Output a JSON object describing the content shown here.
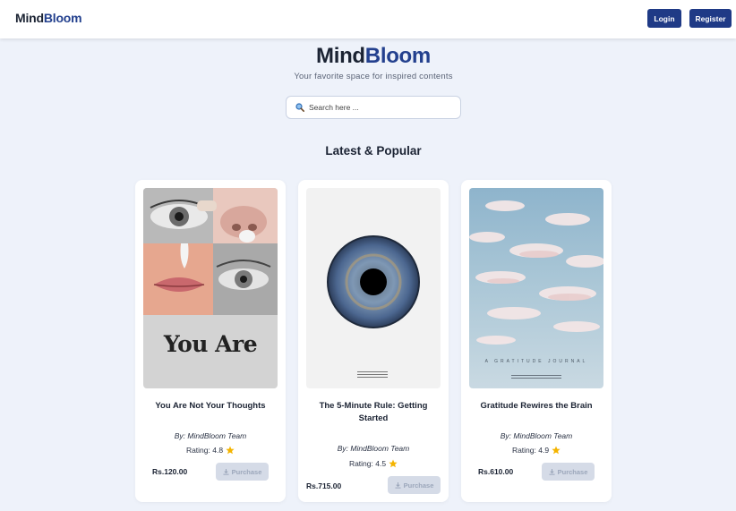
{
  "nav": {
    "logo_part1": "Mind",
    "logo_part2": "Bloom",
    "login_label": "Login",
    "register_label": "Register"
  },
  "hero": {
    "title_part1": "Mind",
    "title_part2": "Bloom",
    "subtitle": "Your favorite space for inspired contents"
  },
  "search": {
    "placeholder": "Search here ...",
    "icon": "search-icon"
  },
  "section": {
    "title": "Latest & Popular"
  },
  "cards": [
    {
      "title": "You Are Not Your Thoughts",
      "cover_text": "You Are",
      "byline": "By: MindBloom Team",
      "rating": "Rating: 4.8",
      "price": "Rs.120.00",
      "purchase_label": "Purchase"
    },
    {
      "title": "The 5-Minute Rule: Getting Started",
      "byline": "By: MindBloom Team",
      "rating": "Rating: 4.5",
      "price": "Rs.715.00",
      "purchase_label": "Purchase"
    },
    {
      "title": "Gratitude Rewires the Brain",
      "cover_text": "A GRATITUDE JOURNAL",
      "byline": "By: MindBloom Team",
      "rating": "Rating: 4.9",
      "price": "Rs.610.00",
      "purchase_label": "Purchase"
    }
  ],
  "colors": {
    "brand_dark": "#1b2333",
    "brand_blue": "#23408e",
    "button_blue": "#1f3a86",
    "page_bg": "#eef2fa",
    "star": "#f4b400",
    "disabled_button": "#d5dbe7"
  }
}
